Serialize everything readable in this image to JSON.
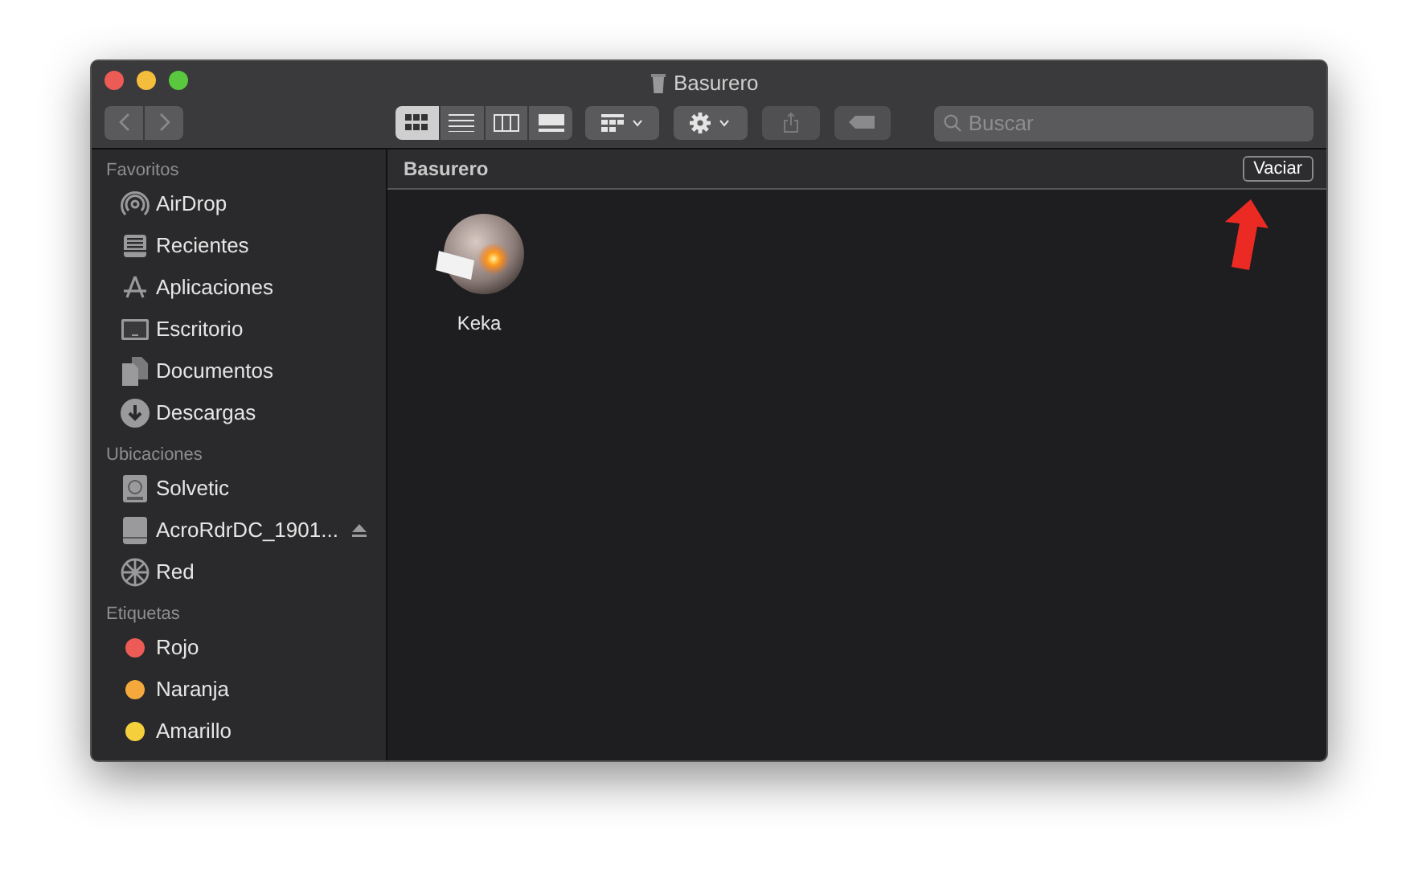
{
  "window": {
    "title": "Basurero"
  },
  "toolbar": {
    "view_modes": [
      {
        "kind": "icons",
        "selected": true
      },
      {
        "kind": "list",
        "selected": false
      },
      {
        "kind": "columns",
        "selected": false
      },
      {
        "kind": "gallery",
        "selected": false
      }
    ],
    "search": {
      "placeholder": "Buscar"
    }
  },
  "sidebar": {
    "sections": [
      {
        "title": "Favoritos",
        "items": [
          {
            "kind": "airdrop",
            "label": "AirDrop"
          },
          {
            "kind": "recents",
            "label": "Recientes"
          },
          {
            "kind": "apps",
            "label": "Aplicaciones"
          },
          {
            "kind": "desktop",
            "label": "Escritorio"
          },
          {
            "kind": "documents",
            "label": "Documentos"
          },
          {
            "kind": "downloads",
            "label": "Descargas"
          }
        ]
      },
      {
        "title": "Ubicaciones",
        "items": [
          {
            "kind": "disk",
            "label": "Solvetic"
          },
          {
            "kind": "volume",
            "label": "AcroRdrDC_1901...",
            "ejectable": true
          },
          {
            "kind": "network",
            "label": "Red"
          }
        ]
      },
      {
        "title": "Etiquetas",
        "items": [
          {
            "kind": "tag",
            "label": "Rojo",
            "color": "#ec5b56"
          },
          {
            "kind": "tag",
            "label": "Naranja",
            "color": "#f5a93c"
          },
          {
            "kind": "tag",
            "label": "Amarillo",
            "color": "#f5d03c"
          }
        ]
      }
    ]
  },
  "path_bar": {
    "title": "Basurero",
    "button": "Vaciar"
  },
  "files": [
    {
      "name": "Keka"
    }
  ]
}
